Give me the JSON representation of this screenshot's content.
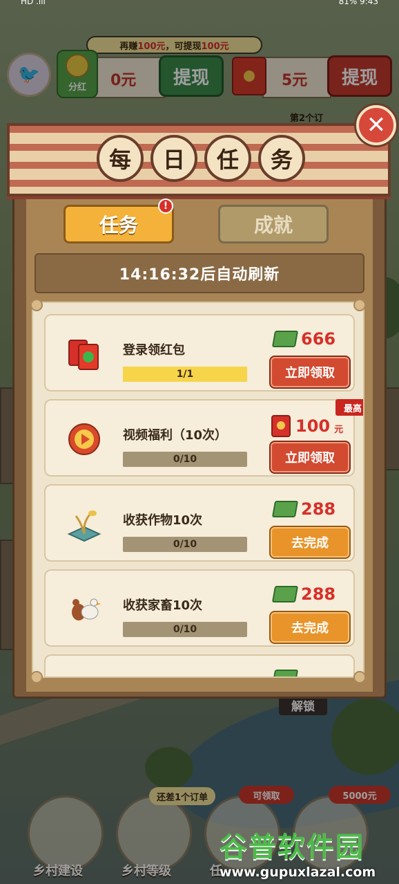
{
  "status_bar": {
    "left": "HD .ıll",
    "right": "81%  9:43"
  },
  "hud": {
    "banner_prefix": "再赚",
    "banner_amount1": "100元",
    "banner_mid": "，可提现",
    "banner_amount2": "100元",
    "fenhong_label": "分红",
    "balance1": "0元",
    "withdraw1": "提现",
    "balance2": "5元",
    "withdraw2": "提现",
    "second_order": "第2个订"
  },
  "dialog": {
    "title_chars": [
      "每",
      "日",
      "任",
      "务"
    ],
    "close_label": "✕",
    "tabs": [
      {
        "label": "任务",
        "active": true,
        "badge": "!"
      },
      {
        "label": "成就",
        "active": false
      }
    ],
    "refresh_text": "14:16:32后自动刷新",
    "tasks": [
      {
        "name": "登录领红包",
        "progress_text": "1/1",
        "progress": 1.0,
        "reward_icon": "cash-icon",
        "reward": "666",
        "unit": "",
        "button": "立即领取",
        "button_style": "red",
        "tag": ""
      },
      {
        "name": "视频福利（10次）",
        "progress_text": "0/10",
        "progress": 0.0,
        "reward_icon": "red-packet-icon",
        "reward": "100",
        "unit": "元",
        "button": "立即领取",
        "button_style": "red",
        "tag": "最高"
      },
      {
        "name": "收获作物10次",
        "progress_text": "0/10",
        "progress": 0.0,
        "reward_icon": "cash-icon",
        "reward": "288",
        "unit": "",
        "button": "去完成",
        "button_style": "orange",
        "tag": ""
      },
      {
        "name": "收获家畜10次",
        "progress_text": "0/10",
        "progress": 0.0,
        "reward_icon": "cash-icon",
        "reward": "288",
        "unit": "",
        "button": "去完成",
        "button_style": "orange",
        "tag": ""
      }
    ]
  },
  "scene": {
    "unlock": "解锁"
  },
  "bottom_menu": {
    "items": [
      {
        "label": "乡村建设"
      },
      {
        "label": "乡村等级",
        "pill": "还差1个订单"
      },
      {
        "label": "任",
        "pill": "可领取"
      },
      {
        "label": "",
        "pill": "5000元"
      }
    ]
  },
  "watermark": {
    "brand": "谷普软件园",
    "url": "www.gupuxlazal.com"
  },
  "colors": {
    "accent_red": "#d6302a",
    "tab_active": "#f4b23a",
    "frame": "#7a5a3a"
  }
}
